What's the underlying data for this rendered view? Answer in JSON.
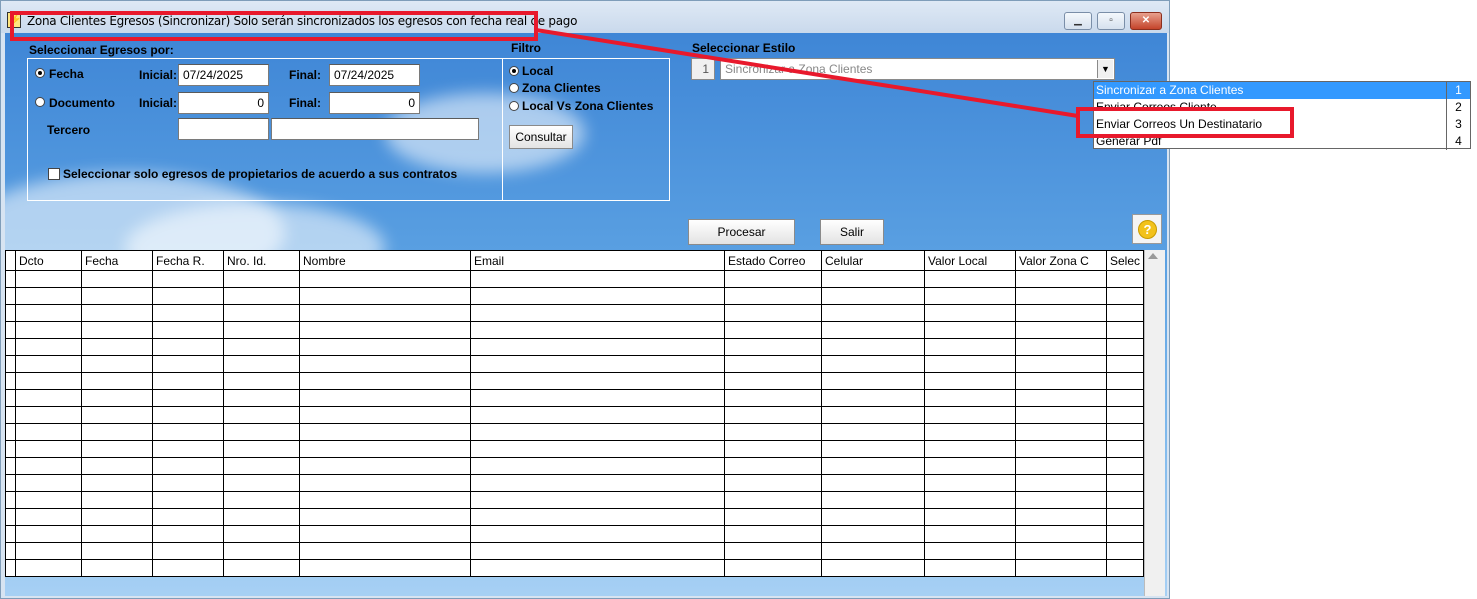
{
  "window": {
    "title": "Zona Clientes Egresos (Sincronizar) Solo serán sincronizados los egresos con fecha real de pago",
    "title_icon": "app-lightning-icon",
    "controls": {
      "minimize": "minimize-icon",
      "maximize": "maximize-icon",
      "close": "close-icon"
    }
  },
  "filters": {
    "section_label": "Seleccionar Egresos por:",
    "fecha": {
      "label": "Fecha",
      "selected": true,
      "inicial_label": "Inicial:",
      "inicial_value": "07/24/2025",
      "final_label": "Final:",
      "final_value": "07/24/2025"
    },
    "documento": {
      "label": "Documento",
      "selected": false,
      "inicial_label": "Inicial:",
      "inicial_value": "0",
      "final_label": "Final:",
      "final_value": "0"
    },
    "tercero": {
      "label": "Tercero",
      "code_value": "",
      "name_value": ""
    },
    "contracts_checkbox": {
      "label": "Seleccionar solo egresos de propietarios de acuerdo a sus contratos",
      "checked": false
    }
  },
  "filtro": {
    "label": "Filtro",
    "options": [
      {
        "label": "Local",
        "selected": true
      },
      {
        "label": "Zona Clientes",
        "selected": false
      },
      {
        "label": "Local Vs Zona Clientes",
        "selected": false
      }
    ],
    "consultar_label": "Consultar"
  },
  "estilo": {
    "label": "Seleccionar Estilo",
    "selected_number": "1",
    "selected_text": "Sincronizar a Zona Clientes",
    "options": [
      {
        "text": "Sincronizar a Zona Clientes",
        "number": "1",
        "selected": true
      },
      {
        "text": "Enviar Correos Cliente",
        "number": "2",
        "selected": false
      },
      {
        "text": "Enviar Correos Un Destinatario",
        "number": "3",
        "selected": false
      },
      {
        "text": "Generar Pdf",
        "number": "4",
        "selected": false
      }
    ]
  },
  "actions": {
    "procesar_label": "Procesar",
    "salir_label": "Salir",
    "help_icon": "help-icon"
  },
  "grid": {
    "columns": [
      "Dcto",
      "Fecha",
      "Fecha R.",
      "Nro. Id.",
      "Nombre",
      "Email",
      "Estado Correo",
      "Celular",
      "Valor Local",
      "Valor Zona C",
      "Selec"
    ],
    "empty_rows": 18
  },
  "colors": {
    "highlight": "#e8192c",
    "selection": "#3399ff",
    "background_sky": "#4a93dd"
  }
}
